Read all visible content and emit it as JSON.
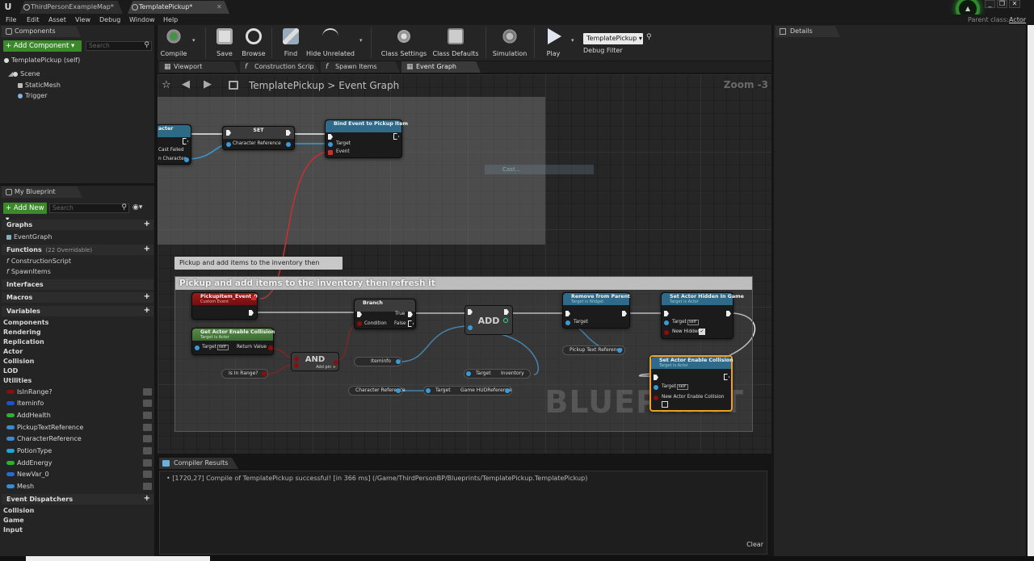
{
  "tabs": [
    {
      "label": "ThirdPersonExampleMap*"
    },
    {
      "label": "TemplatePickup*"
    }
  ],
  "menu": [
    "File",
    "Edit",
    "Asset",
    "View",
    "Debug",
    "Window",
    "Help"
  ],
  "parent_class": {
    "label": "Parent class:",
    "value": "Actor"
  },
  "window_controls": {
    "minimize": "_",
    "restore": "❐",
    "close": "✕"
  },
  "components_panel": {
    "tab": "Components",
    "add_button": "+ Add Component ▾",
    "search_placeholder": "Search",
    "self_item": "TemplatePickup (self)",
    "items": [
      "Scene",
      "StaticMesh",
      "Trigger"
    ]
  },
  "my_blueprint": {
    "tab": "My Blueprint",
    "add_button": "+ Add New ▾",
    "search_placeholder": "Search",
    "graphs": {
      "label": "Graphs",
      "items": [
        "EventGraph"
      ]
    },
    "functions": {
      "label": "Functions",
      "note": "(22 Overridable)",
      "items": [
        "ConstructionScript",
        "SpawnItems"
      ]
    },
    "interfaces": "Interfaces",
    "macros": "Macros",
    "variables": {
      "label": "Variables",
      "categories": [
        "Components",
        "Rendering",
        "Replication",
        "Actor",
        "Collision",
        "LOD",
        "Utilities"
      ],
      "items": [
        {
          "name": "IsInRange?",
          "color": "#8b0e0e"
        },
        {
          "name": "Iteminfo",
          "color": "#2050d0"
        },
        {
          "name": "AddHealth",
          "color": "#30b030"
        },
        {
          "name": "PickupTextReference",
          "color": "#3a8ad0"
        },
        {
          "name": "CharacterReference",
          "color": "#3a8ad0"
        },
        {
          "name": "PotionType",
          "color": "#1aa8d8"
        },
        {
          "name": "AddEnergy",
          "color": "#30b030"
        },
        {
          "name": "NewVar_0",
          "color": "#2a6ad0"
        },
        {
          "name": "Mesh",
          "color": "#3a8ad0"
        }
      ]
    },
    "event_dispatchers": {
      "label": "Event Dispatchers",
      "items": [
        "Collision",
        "Game",
        "Input"
      ]
    }
  },
  "toolbar": {
    "compile": "Compile",
    "save": "Save",
    "browse": "Browse",
    "find": "Find",
    "hide_unrelated": "Hide Unrelated",
    "class_settings": "Class Settings",
    "class_defaults": "Class Defaults",
    "simulation": "Simulation",
    "play": "Play",
    "debug_object": "TemplatePickup ▾",
    "debug_filter": "Debug Filter"
  },
  "graph_tabs": [
    "Viewport",
    "Construction Scrip",
    "Spawn Items",
    "Event Graph"
  ],
  "breadcrumb": {
    "root": "TemplatePickup",
    "sep": ">",
    "current": "Event Graph"
  },
  "zoom": "Zoom -3",
  "watermark": "BLUEPRINT",
  "comment_bubble": "Pickup and add items to the inventory then refresh it",
  "comment_title": "Pickup and add items to the inventory then refresh it",
  "faint_node_label": "Cast...",
  "nodes": {
    "cast": {
      "title": "acter",
      "cast_failed": "Cast Failed",
      "as_character": "n Character"
    },
    "set": {
      "title": "SET",
      "pin": "Character Reference"
    },
    "bind": {
      "title": "Bind Event to Pickup Item",
      "target": "Target",
      "event": "Event"
    },
    "custom_event": {
      "title": "PickupItem_Event_0",
      "subtitle": "Custom Event"
    },
    "get_collision": {
      "title": "Get Actor Enable Collision",
      "subtitle": "Target is Actor",
      "target": "Target",
      "self": "self",
      "return": "Return Value"
    },
    "is_in_range": "Is In Range?",
    "and": {
      "title": "AND",
      "add_pin": "Add pin +"
    },
    "branch": {
      "title": "Branch",
      "condition": "Condition",
      "true": "True",
      "false": "False"
    },
    "iteminfo": "Iteminfo",
    "add": "ADD",
    "target_inventory": {
      "target": "Target",
      "inventory": "Inventory"
    },
    "character_reference": "Character Reference",
    "game_hud": {
      "target": "Target",
      "value": "Game HUDReference"
    },
    "remove_parent": {
      "title": "Remove from Parent",
      "subtitle": "Target is Widget",
      "target": "Target"
    },
    "pickup_text_ref": "Pickup Text Reference",
    "set_hidden": {
      "title": "Set Actor Hidden In Game",
      "subtitle": "Target is Actor",
      "target": "Target",
      "self": "self",
      "new_hidden": "New Hidden"
    },
    "set_collision": {
      "title": "Set Actor Enable Collision",
      "subtitle": "Target is Actor",
      "target": "Target",
      "self": "self",
      "new_collision": "New Actor Enable Collision"
    }
  },
  "compiler": {
    "tab": "Compiler Results",
    "message": "[1720,27] Compile of TemplatePickup successful! [in 366 ms] (/Game/ThirdPersonBP/Blueprints/TemplatePickup.TemplatePickup)",
    "clear": "Clear"
  },
  "details": {
    "tab": "Details"
  }
}
